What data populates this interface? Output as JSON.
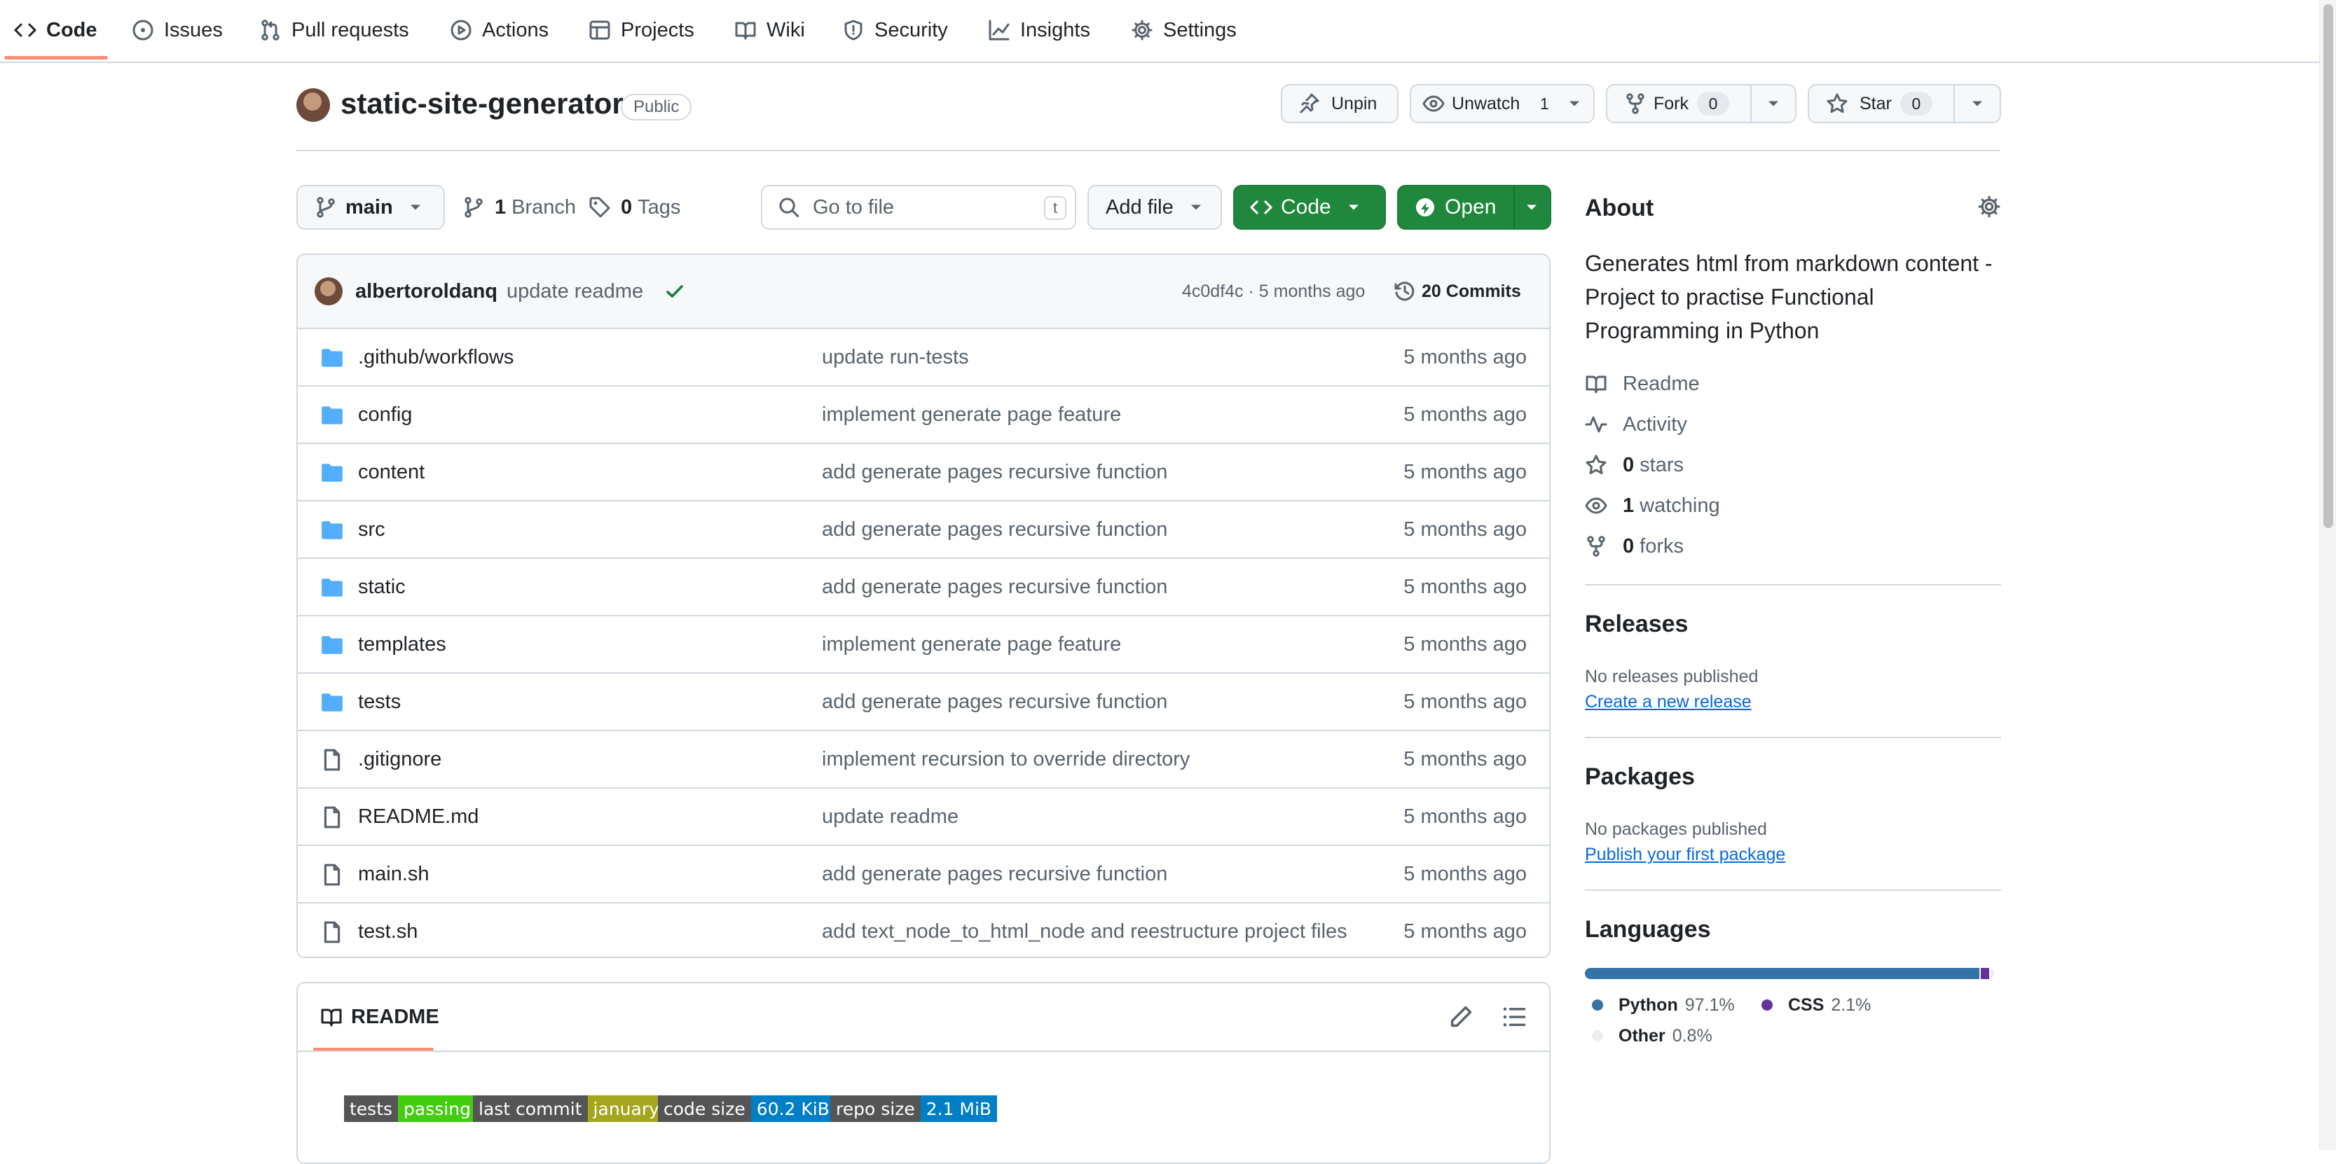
{
  "nav": {
    "items": [
      {
        "label": "Code",
        "icon": "code-icon",
        "active": true
      },
      {
        "label": "Issues",
        "icon": "issue-opened-icon"
      },
      {
        "label": "Pull requests",
        "icon": "git-pull-request-icon"
      },
      {
        "label": "Actions",
        "icon": "play-icon"
      },
      {
        "label": "Projects",
        "icon": "table-icon"
      },
      {
        "label": "Wiki",
        "icon": "book-icon"
      },
      {
        "label": "Security",
        "icon": "shield-icon"
      },
      {
        "label": "Insights",
        "icon": "graph-icon"
      },
      {
        "label": "Settings",
        "icon": "gear-icon"
      }
    ]
  },
  "repo": {
    "name": "static-site-generator",
    "visibility": "Public",
    "unpin_label": "Unpin",
    "unwatch_label": "Unwatch",
    "watch_count": "1",
    "fork_label": "Fork",
    "fork_count": "0",
    "star_label": "Star",
    "star_count": "0"
  },
  "toolbar": {
    "branch": "main",
    "branches_count": "1",
    "branches_label": "Branch",
    "tags_count": "0",
    "tags_label": "Tags",
    "search_placeholder": "Go to file",
    "search_shortcut": "t",
    "add_file_label": "Add file",
    "code_label": "Code",
    "open_label": "Open"
  },
  "latest_commit": {
    "author": "albertoroldanq",
    "message": "update readme",
    "status": "success",
    "hash": "4c0df4c",
    "age": "5 months ago",
    "commits_count": "20",
    "commits_label": "Commits"
  },
  "files": [
    {
      "name": ".github/workflows",
      "type": "dir",
      "message": "update run-tests",
      "age": "5 months ago"
    },
    {
      "name": "config",
      "type": "dir",
      "message": "implement generate page feature",
      "age": "5 months ago"
    },
    {
      "name": "content",
      "type": "dir",
      "message": "add generate pages recursive function",
      "age": "5 months ago"
    },
    {
      "name": "src",
      "type": "dir",
      "message": "add generate pages recursive function",
      "age": "5 months ago"
    },
    {
      "name": "static",
      "type": "dir",
      "message": "add generate pages recursive function",
      "age": "5 months ago"
    },
    {
      "name": "templates",
      "type": "dir",
      "message": "implement generate page feature",
      "age": "5 months ago"
    },
    {
      "name": "tests",
      "type": "dir",
      "message": "add generate pages recursive function",
      "age": "5 months ago"
    },
    {
      "name": ".gitignore",
      "type": "file",
      "message": "implement recursion to override directory",
      "age": "5 months ago"
    },
    {
      "name": "README.md",
      "type": "file",
      "message": "update readme",
      "age": "5 months ago"
    },
    {
      "name": "main.sh",
      "type": "file",
      "message": "add generate pages recursive function",
      "age": "5 months ago"
    },
    {
      "name": "test.sh",
      "type": "file",
      "message": "add text_node_to_html_node and reestructure project files",
      "age": "5 months ago"
    }
  ],
  "readme": {
    "tab_label": "README",
    "badges": [
      {
        "label": "tests",
        "value": "passing",
        "color": "#4c1"
      },
      {
        "label": "last commit",
        "value": "january",
        "color": "#a4a61d"
      },
      {
        "label": "code size",
        "value": "60.2 KiB",
        "color": "#007ec6"
      },
      {
        "label": "repo size",
        "value": "2.1 MiB",
        "color": "#007ec6"
      }
    ]
  },
  "about": {
    "title": "About",
    "description": "Generates html from markdown content - Project to practise Functional Programming in Python",
    "links": [
      {
        "icon": "book-icon",
        "count": "",
        "label": "Readme"
      },
      {
        "icon": "pulse-icon",
        "count": "",
        "label": "Activity"
      },
      {
        "icon": "star-icon",
        "count": "0",
        "label": "stars"
      },
      {
        "icon": "eye-icon",
        "count": "1",
        "label": "watching"
      },
      {
        "icon": "repo-forked-icon",
        "count": "0",
        "label": "forks"
      }
    ]
  },
  "releases": {
    "title": "Releases",
    "empty_text": "No releases published",
    "link": "Create a new release"
  },
  "packages": {
    "title": "Packages",
    "empty_text": "No packages published",
    "link": "Publish your first package"
  },
  "languages": {
    "title": "Languages",
    "items": [
      {
        "name": "Python",
        "percent": "97.1%",
        "value": 97.1,
        "color": "#3572A5"
      },
      {
        "name": "CSS",
        "percent": "2.1%",
        "value": 2.1,
        "color": "#663399"
      },
      {
        "name": "Other",
        "percent": "0.8%",
        "value": 0.8,
        "color": "#ededed"
      }
    ]
  },
  "colors": {
    "accent_underline": "#fd8c73",
    "primary_button": "#1f883d",
    "link": "#0969da",
    "folder": "#54aeff"
  }
}
